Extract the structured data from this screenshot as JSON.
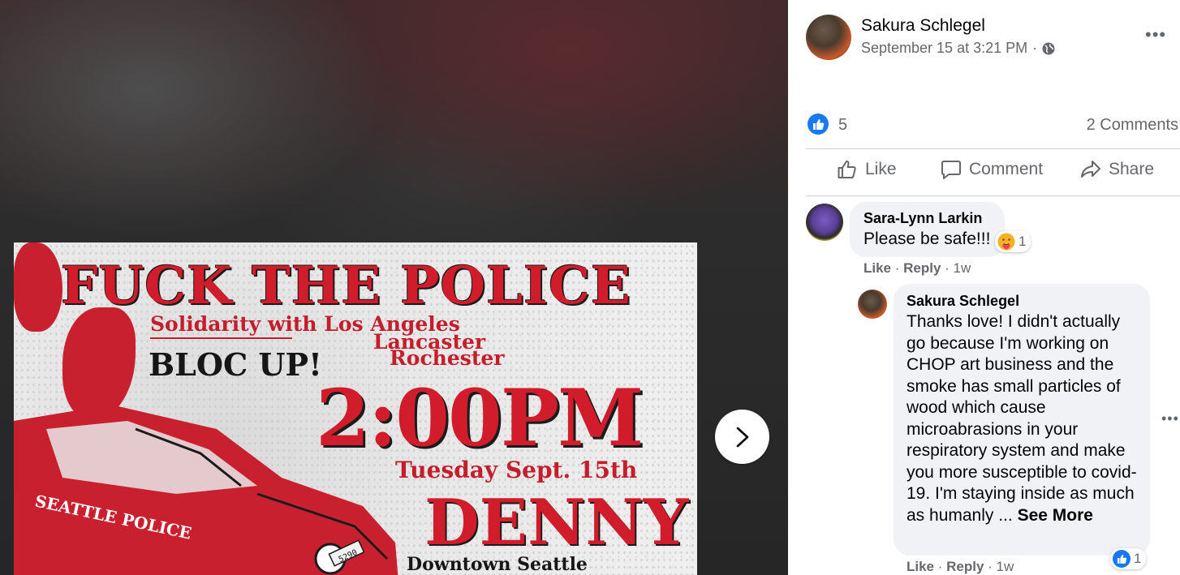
{
  "poster": {
    "headline": "FUCK THE POLICE",
    "solidarity": "Solidarity with Los Angeles",
    "city1": "Lancaster",
    "city2": "Rochester",
    "bloc": "BLOC UP!",
    "time": "2:00PM",
    "date": "Tuesday Sept. 15th",
    "place": "DENNY PARK",
    "downtown": "Downtown Seattle",
    "car_label": "SEATTLE POLICE",
    "car_plate": "5290"
  },
  "post": {
    "author": "Sakura Schlegel",
    "timestamp": "September 15 at 3:21 PM",
    "separator": "·",
    "more_icon": "•••",
    "like_count": "5",
    "comments_count": "2 Comments"
  },
  "actions": {
    "like": "Like",
    "comment": "Comment",
    "share": "Share"
  },
  "comments": [
    {
      "name": "Sara-Lynn Larkin",
      "text": "Please be safe!!!",
      "reaction_count": "1",
      "like": "Like",
      "reply": "Reply",
      "sep": " · ",
      "age": "1w"
    },
    {
      "name": "Sakura Schlegel",
      "text": "Thanks love! I didn't actually go because I'm working on CHOP art business and the smoke has small particles of wood which cause microabrasions in your respiratory system and make you more susceptible to covid-19. I'm staying inside as much as humanly ... ",
      "see_more": "See More",
      "reaction_count": "1",
      "options_icon": "•••",
      "like": "Like",
      "reply": "Reply",
      "sep": " · ",
      "age": "1w"
    }
  ],
  "colors": {
    "fb_blue": "#1877f2",
    "poster_red": "#d11d2b",
    "secondary_text": "#65676b",
    "bubble_bg": "#f0f2f5"
  }
}
